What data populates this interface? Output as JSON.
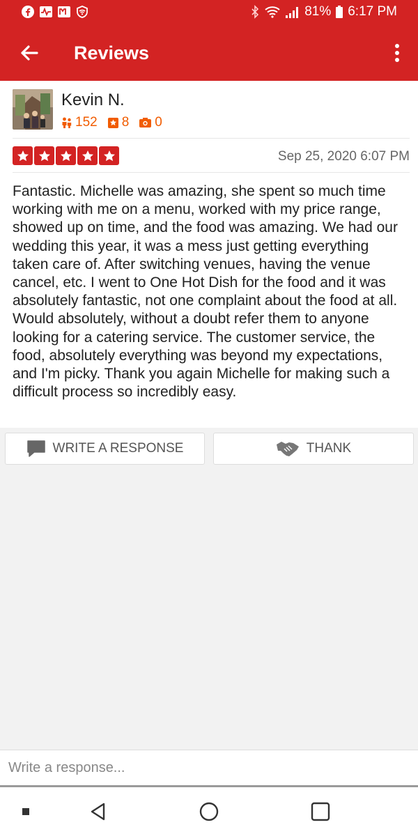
{
  "status_bar": {
    "battery": "81%",
    "time": "6:17 PM"
  },
  "app_bar": {
    "title": "Reviews"
  },
  "review": {
    "author": "Kevin N.",
    "stats": {
      "friends": "152",
      "reviews": "8",
      "photos": "0"
    },
    "rating": 5,
    "date": "Sep 25, 2020 6:07 PM",
    "text": "Fantastic. Michelle was amazing, she spent so much time working with me on a menu, worked with my price range, showed up on time, and the food was amazing. We had our wedding this year, it was a mess just getting everything taken care of. After switching venues, having the venue cancel, etc. I went to One Hot Dish for the food and it was absolutely fantastic, not one complaint about the food at all. Would absolutely, without a doubt refer them to anyone looking for a catering service. The customer service, the food, absolutely everything was beyond my expectations, and I'm picky. Thank you again Michelle for making such a difficult process so incredibly easy."
  },
  "actions": {
    "respond_label": "WRITE A RESPONSE",
    "thank_label": "THANK"
  },
  "reply": {
    "placeholder": "Write a response..."
  },
  "colors": {
    "brand_red": "#d32323",
    "stat_orange": "#f15c00"
  }
}
